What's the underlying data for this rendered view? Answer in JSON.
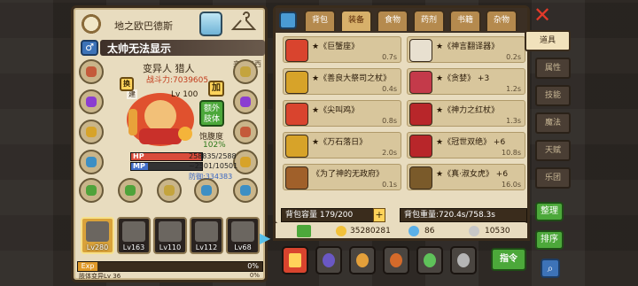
{
  "character": {
    "title": "地之欧巴德斯",
    "class_title": "太帅无法显示",
    "origin": "来自江西",
    "race_job": "变异人 猎人",
    "power_label": "战斗力:7039605",
    "name_tag": "建",
    "level": "Lv 100",
    "swap_label": "换",
    "plus_label": "加",
    "extra_body_label": "额外肢体",
    "satiety_label": "饱腹度",
    "satiety_value": "102%",
    "hp_tag": "HP",
    "mp_tag": "MP",
    "hp_value": "258835/2588",
    "mp_value": "~2501/10501",
    "defense_value": "防御:334383",
    "hp_fraction": 0.99,
    "mp_fraction": 0.24,
    "companions": [
      {
        "level": "Lv280",
        "selected": true
      },
      {
        "level": "Lv163",
        "selected": false
      },
      {
        "level": "Lv110",
        "selected": false
      },
      {
        "level": "Lv112",
        "selected": false
      },
      {
        "level": "Lv68",
        "selected": false
      }
    ],
    "exp_tag": "Exp",
    "exp_pct": "0%",
    "sub_text": "肢体变异Lv 36",
    "sub_pct": "0%"
  },
  "inventory": {
    "tabs": [
      "背包",
      "装备",
      "食物",
      "药剂",
      "书籍",
      "杂物"
    ],
    "active_tab": 1,
    "items": [
      {
        "name": "★《巨蟹座》",
        "time": "0.7s",
        "color": "#d9442e"
      },
      {
        "name": "★《神言翻译器》",
        "time": "0.2s",
        "color": "#e8e0d0"
      },
      {
        "name": "★《善良大祭司之杖》",
        "time": "0.4s",
        "color": "#d7a329"
      },
      {
        "name": "★《贪婪》 +3",
        "time": "1.2s",
        "color": "#c43a4a"
      },
      {
        "name": "★《尖叫鸡》",
        "time": "0.8s",
        "color": "#d9442e"
      },
      {
        "name": "★《神力之红杖》",
        "time": "1.3s",
        "color": "#b8262a"
      },
      {
        "name": "★《万石落日》",
        "time": "2.0s",
        "color": "#d7a329"
      },
      {
        "name": "★《冠世双绝》 +6",
        "time": "10.8s",
        "color": "#b8262a"
      },
      {
        "name": "《为了神的无政府》",
        "time": "0.1s",
        "color": "#a0602a"
      },
      {
        "name": "★《真·淑女虎》 +6",
        "time": "16.0s",
        "color": "#7a5a2a"
      }
    ],
    "capacity_label": "背包容量 179/200",
    "capacity_plus": "+",
    "weight_label": "背包重量:720.4s/758.3s"
  },
  "currency": {
    "gold": "35280281",
    "gem": "86",
    "silver": "10530"
  },
  "actions": {
    "command_label": "指令"
  },
  "side_tabs": [
    "道具",
    "属性",
    "技能",
    "魔法",
    "天赋",
    "乐团"
  ],
  "side_active": 0,
  "side_buttons": {
    "manage": "整理",
    "sort": "排序"
  },
  "icons": {
    "close": "✕",
    "search": "⌕",
    "next": "▶"
  },
  "colors": {
    "panel": "#e8dcbf",
    "border": "#3a2c1c",
    "accent_green": "#4ca83a",
    "accent_blue": "#3d73b8"
  }
}
